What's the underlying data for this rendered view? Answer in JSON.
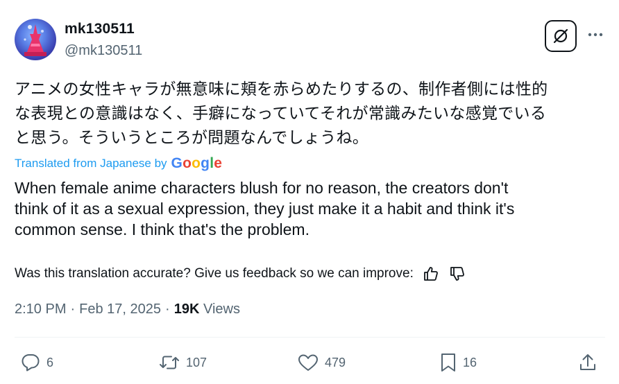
{
  "author": {
    "display_name": "mk130511",
    "handle": "@mk130511",
    "avatar_icon": "avatar-image"
  },
  "header_actions": {
    "grok_icon": "grok-icon",
    "more_icon": "more-icon"
  },
  "post": {
    "text_ja_lines": [
      "アニメの女性キャラが無意味に頬を赤らめたりするの、制作者側には性的",
      "な表現との意識はなく、手癖になっていてそれが常識みたいな感覚でいる",
      "と思う。そういうところが問題なんでしょうね。"
    ],
    "translated_from": "Translated from Japanese by",
    "translation_provider": "Google",
    "text_en_lines": [
      "When female anime characters blush for no reason, the creators don't",
      "think of it as a sexual expression, they just make it a habit and think it's",
      "common sense. I think that's the problem."
    ]
  },
  "feedback": {
    "prompt": "Was this translation accurate? Give us feedback so we can improve:",
    "up_icon": "thumbs-up-icon",
    "down_icon": "thumbs-down-icon"
  },
  "meta": {
    "time": "2:10 PM",
    "separator": "·",
    "date": "Feb 17, 2025",
    "views_count": "19K",
    "views_label": "Views"
  },
  "actions": {
    "replies": "6",
    "reposts": "107",
    "likes": "479",
    "bookmarks": "16"
  },
  "colors": {
    "text": "#0f1419",
    "secondary": "#536471",
    "link": "#1d9bf0",
    "divider": "#eff3f4"
  }
}
